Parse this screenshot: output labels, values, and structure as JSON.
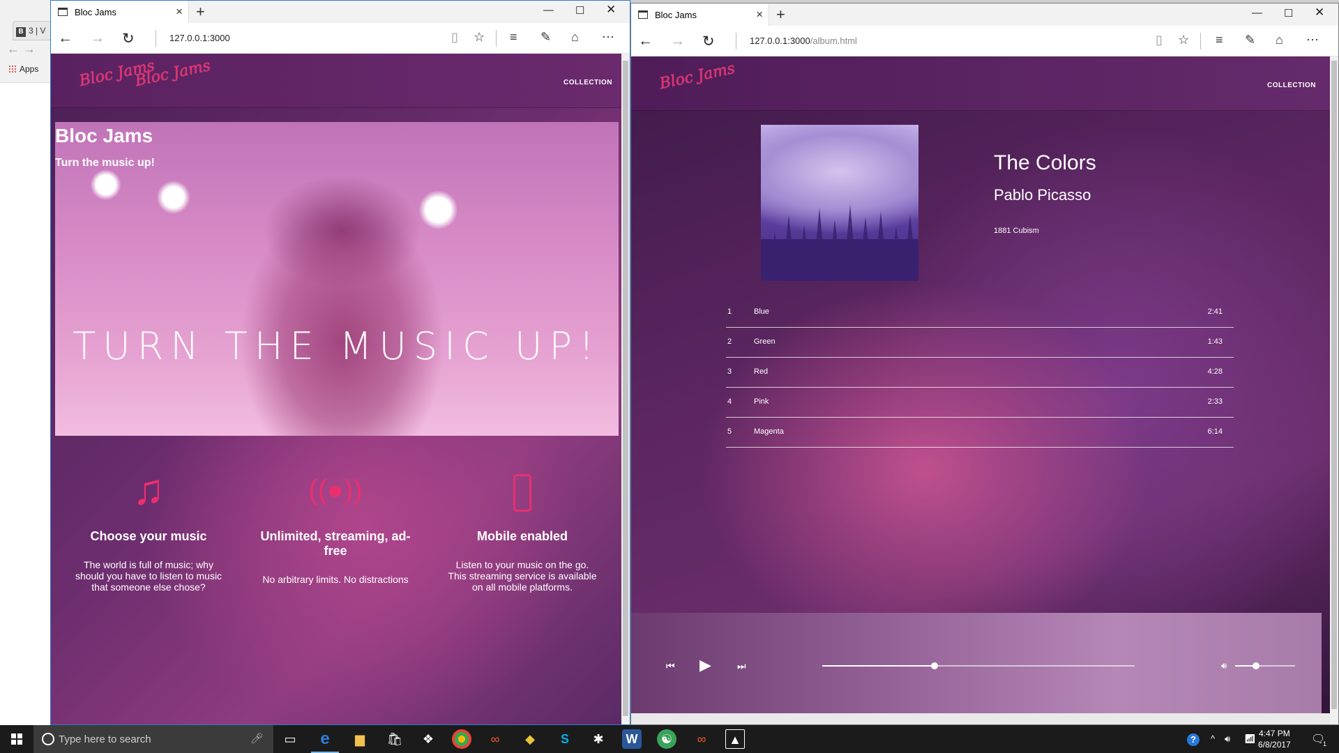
{
  "chrome": {
    "tab_badge": "B",
    "tab_label": "3 | V",
    "apps_label": "Apps"
  },
  "left_window": {
    "tab_title": "Bloc Jams",
    "url": "127.0.0.1:3000",
    "nav": {
      "collection": "COLLECTION"
    },
    "logo_text": "Bloc Jams",
    "hero": {
      "title": "Bloc Jams",
      "subtitle": "Turn the music up!",
      "tagline": "TURN THE MUSIC UP!"
    },
    "features": [
      {
        "icon": "music-note-icon",
        "title": "Choose your music",
        "desc": "The world is full of music; why should you have to listen to music that someone else chose?"
      },
      {
        "icon": "broadcast-icon",
        "title": "Unlimited, streaming, ad-free",
        "desc": "No arbitrary limits. No distractions"
      },
      {
        "icon": "mobile-icon",
        "title": "Mobile enabled",
        "desc": "Listen to your music on the go. This streaming service is available on all mobile platforms."
      }
    ]
  },
  "right_window": {
    "tab_title": "Bloc Jams",
    "url_host": "127.0.0.1:3000",
    "url_path": "/album.html",
    "nav": {
      "collection": "COLLECTION"
    },
    "logo_text": "Bloc Jams",
    "album": {
      "title": "The Colors",
      "artist": "Pablo Picasso",
      "meta": "1881 Cubism"
    },
    "songs": [
      {
        "num": "1",
        "title": "Blue",
        "duration": "2:41"
      },
      {
        "num": "2",
        "title": "Green",
        "duration": "1:43"
      },
      {
        "num": "3",
        "title": "Red",
        "duration": "4:28"
      },
      {
        "num": "4",
        "title": "Pink",
        "duration": "2:33"
      },
      {
        "num": "5",
        "title": "Magenta",
        "duration": "6:14"
      }
    ],
    "player": {
      "seek_progress": 0.36,
      "volume_level": 0.35
    }
  },
  "taskbar": {
    "search_placeholder": "Type here to search",
    "time": "4:47 PM",
    "date": "6/8/2017",
    "notification_count": "1"
  },
  "colors": {
    "accent_pink": "#e8306f",
    "edge_active_border": "#2b79d8",
    "taskbar": "#1b1b1b"
  }
}
